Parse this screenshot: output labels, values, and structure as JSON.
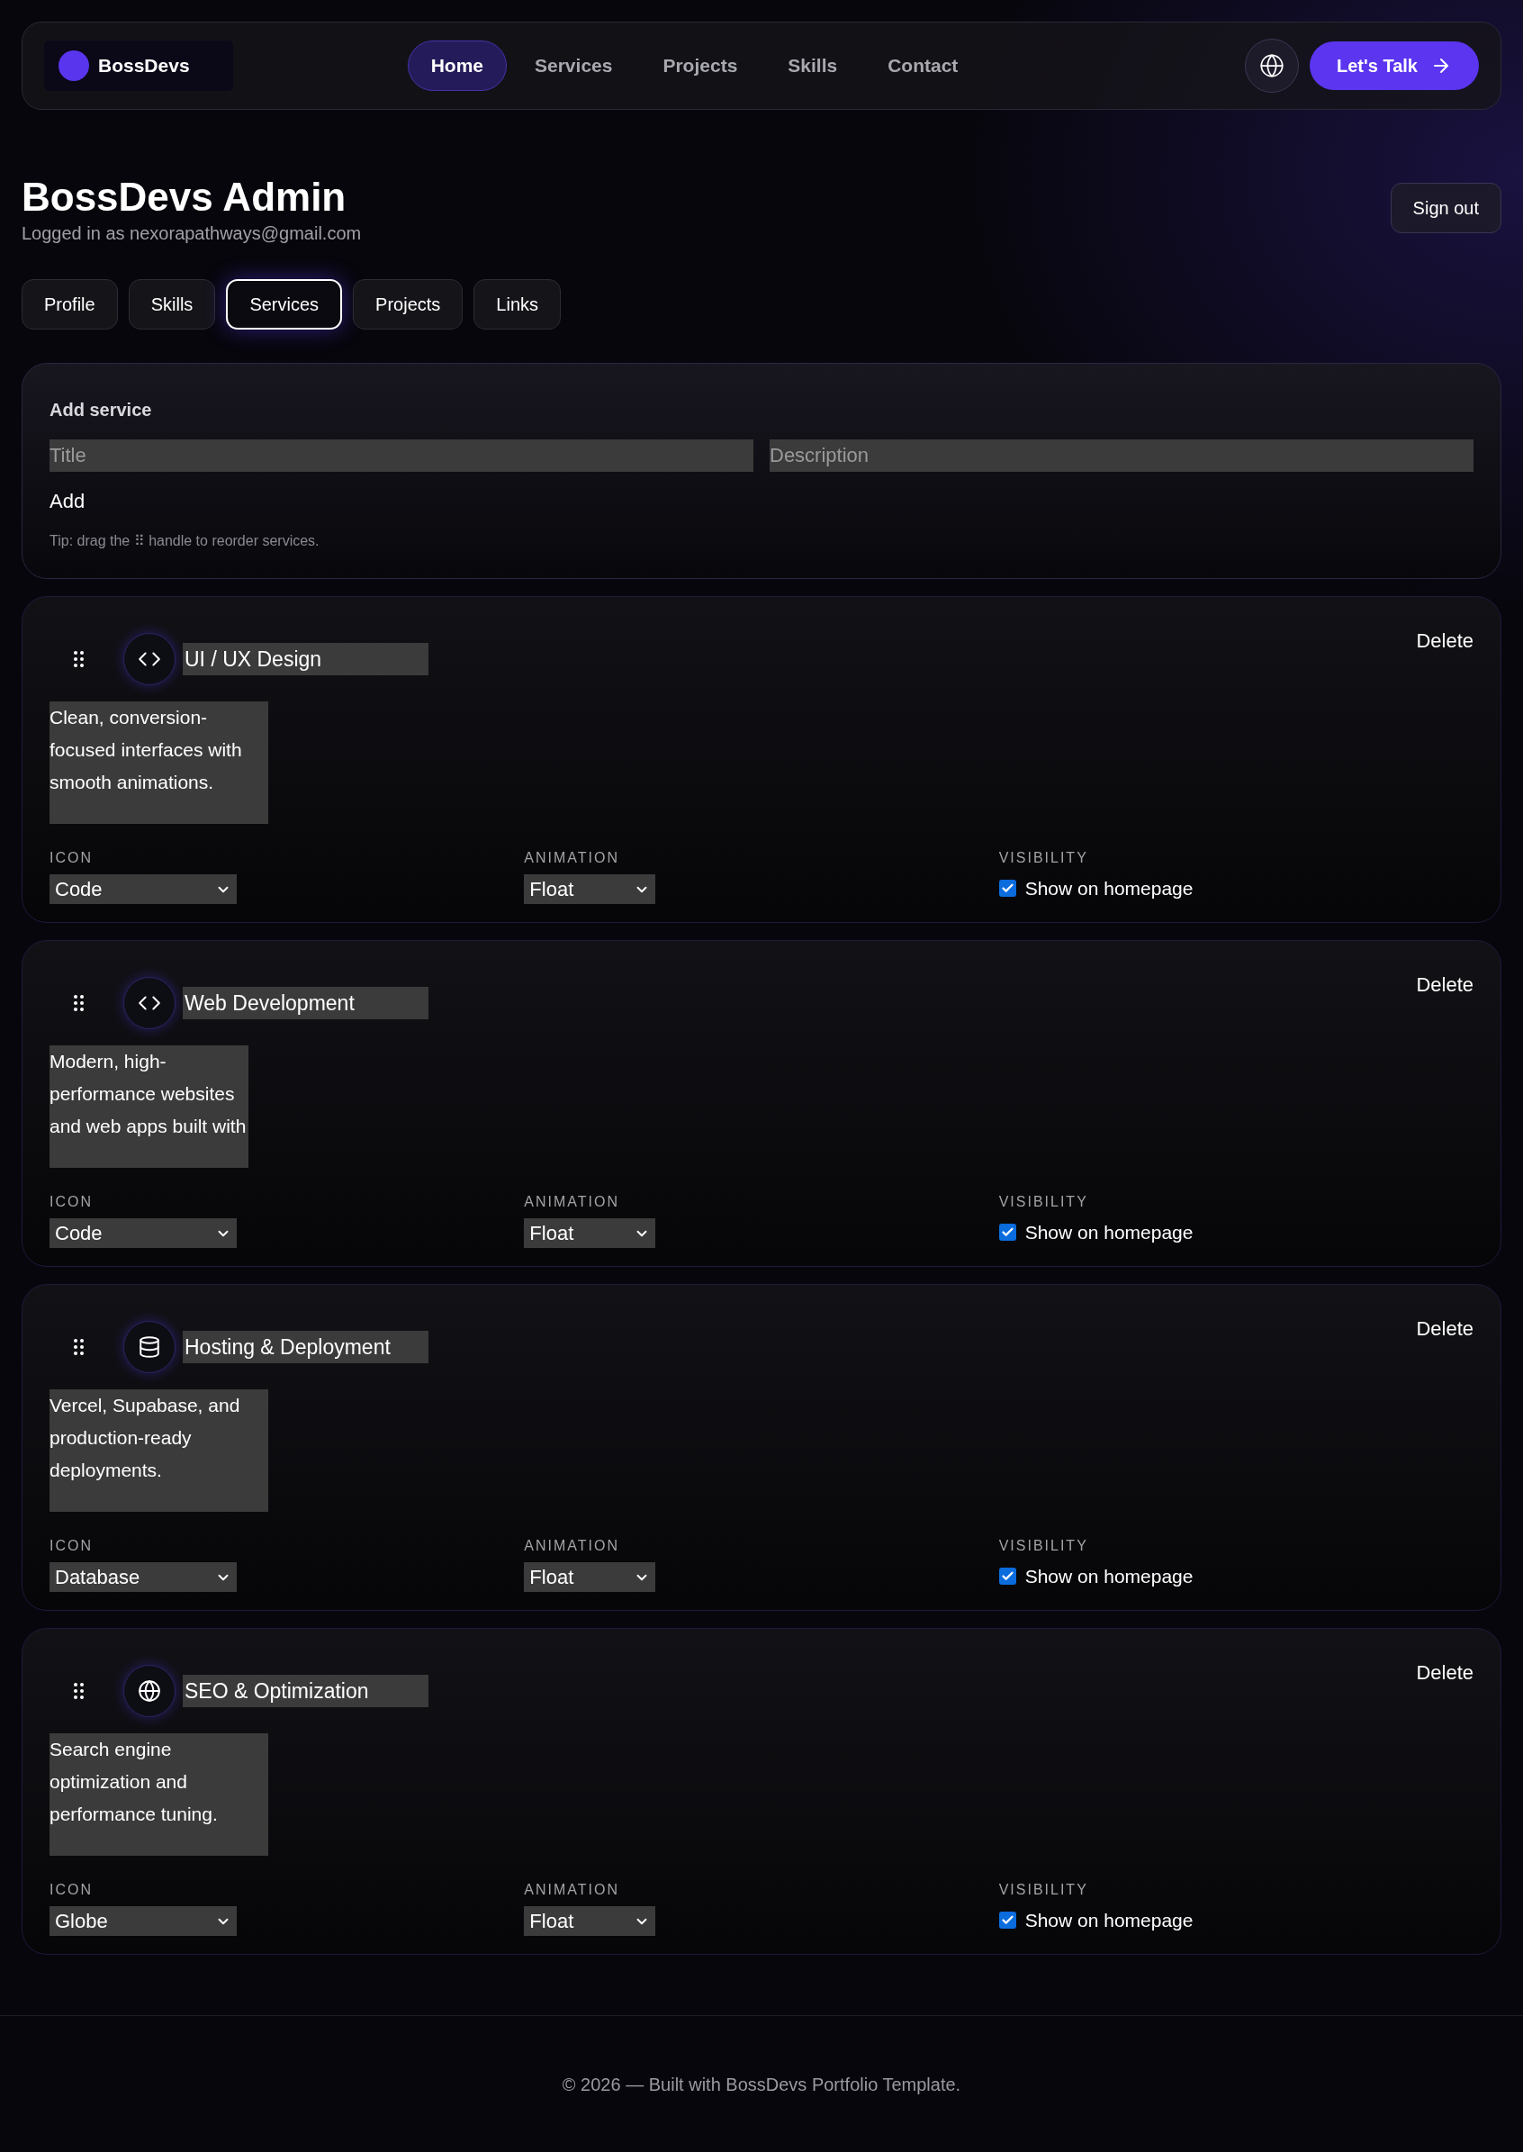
{
  "nav": {
    "brand": "BossDevs",
    "items": [
      {
        "label": "Home",
        "selected": true
      },
      {
        "label": "Services",
        "selected": false
      },
      {
        "label": "Projects",
        "selected": false
      },
      {
        "label": "Skills",
        "selected": false
      },
      {
        "label": "Contact",
        "selected": false
      }
    ],
    "cta": "Let's Talk"
  },
  "header": {
    "title": "BossDevs Admin",
    "subtitle": "Logged in as nexorapathways@gmail.com",
    "sign_out": "Sign out"
  },
  "tabs": [
    {
      "label": "Profile",
      "selected": false
    },
    {
      "label": "Skills",
      "selected": false
    },
    {
      "label": "Services",
      "selected": true
    },
    {
      "label": "Projects",
      "selected": false
    },
    {
      "label": "Links",
      "selected": false
    }
  ],
  "add_service": {
    "heading": "Add service",
    "title_placeholder": "Title",
    "description_placeholder": "Description",
    "add": "Add",
    "tip": "Tip: drag the ⠿ handle to reorder services."
  },
  "services": [
    {
      "kind": "code",
      "title": "UI / UX Design",
      "delete": "Delete",
      "description": "Clean, conversion-focused interfaces with smooth animations.",
      "icon_label": "ICON",
      "icon": "Code",
      "animation_label": "ANIMATION",
      "animation": "Float",
      "visibility_label": "VISIBILITY",
      "show_label": "Show on homepage",
      "visible": true
    },
    {
      "kind": "code",
      "title": "Web Development",
      "delete": "Delete",
      "description": "Modern, high-performance websites and web apps built with",
      "icon_label": "ICON",
      "icon": "Code",
      "animation_label": "ANIMATION",
      "animation": "Float",
      "visibility_label": "VISIBILITY",
      "show_label": "Show on homepage",
      "visible": true
    },
    {
      "kind": "database",
      "title": "Hosting & Deployment",
      "delete": "Delete",
      "description": "Vercel, Supabase, and production-ready deployments.",
      "icon_label": "ICON",
      "icon": "Database",
      "animation_label": "ANIMATION",
      "animation": "Float",
      "visibility_label": "VISIBILITY",
      "show_label": "Show on homepage",
      "visible": true
    },
    {
      "kind": "globe",
      "title": "SEO & Optimization",
      "delete": "Delete",
      "description": "Search engine optimization and performance tuning.",
      "icon_label": "ICON",
      "icon": "Globe",
      "animation_label": "ANIMATION",
      "animation": "Float",
      "visibility_label": "VISIBILITY",
      "show_label": "Show on homepage",
      "visible": true
    }
  ],
  "footer": "© 2026 — Built with BossDevs Portfolio Template."
}
